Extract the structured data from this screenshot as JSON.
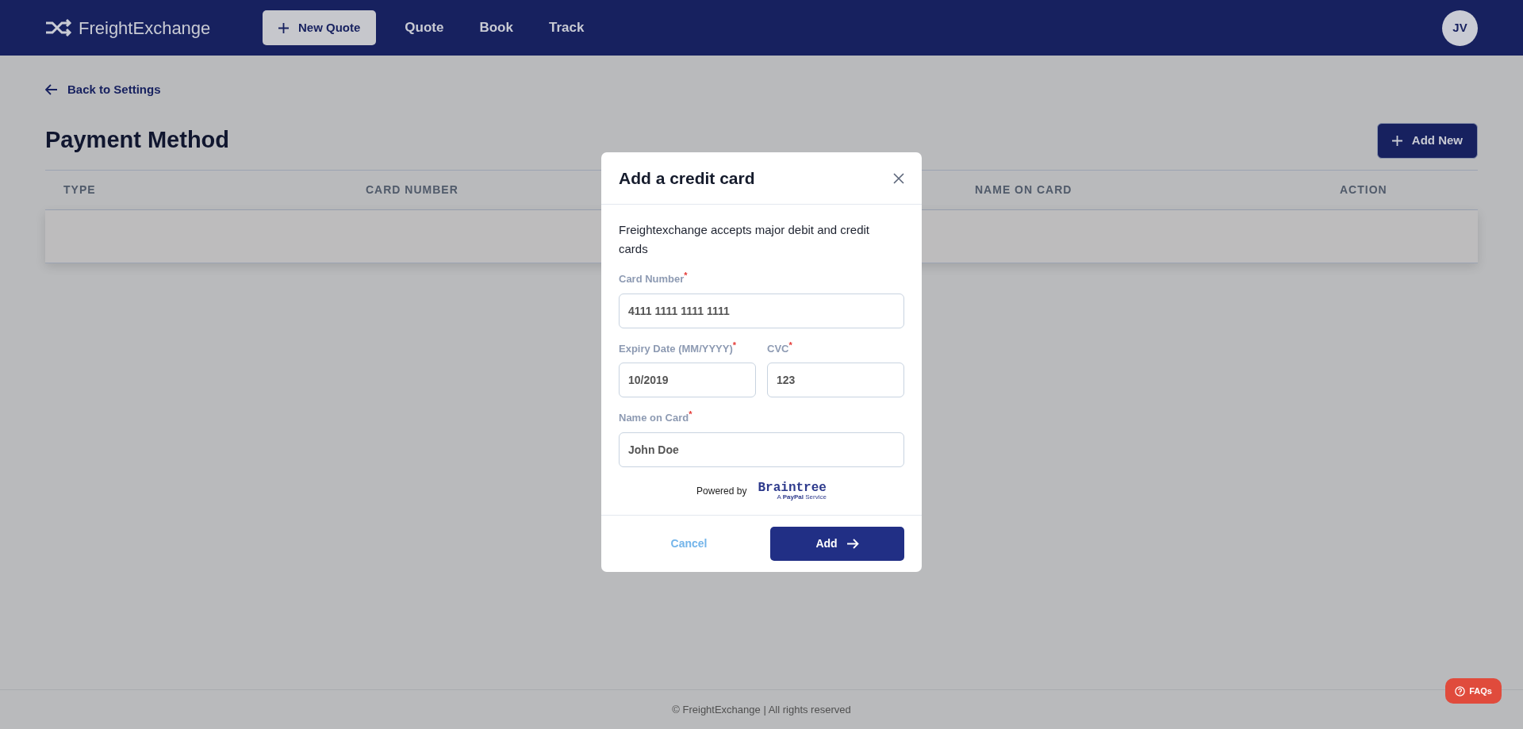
{
  "header": {
    "brand": "FreightExchange",
    "new_quote": "New Quote",
    "nav": [
      {
        "label": "Quote"
      },
      {
        "label": "Book"
      },
      {
        "label": "Track"
      }
    ],
    "avatar": "JV"
  },
  "back_link": "Back to Settings",
  "page_title": "Payment Method",
  "add_new": "Add New",
  "table": {
    "columns": [
      {
        "label": "TYPE"
      },
      {
        "label": "CARD NUMBER"
      },
      {
        "label": "NAME ON CARD"
      },
      {
        "label": "ACTION"
      }
    ]
  },
  "modal": {
    "title": "Add a credit card",
    "intro": "Freightexchange accepts major debit and credit cards",
    "fields": [
      {
        "label": "Card Number",
        "required_mark": "*",
        "value": "4111 1111 1111 1111"
      },
      {
        "label": "Expiry Date (MM/YYYY)",
        "required_mark": "*",
        "value": "10/2019"
      },
      {
        "label": "CVC",
        "required_mark": "*",
        "value": "123"
      },
      {
        "label": "Name on Card",
        "required_mark": "*",
        "value": "John Doe"
      }
    ],
    "powered_by": "Powered by",
    "logo_name": "Braintree",
    "logo_tagline": "A **PayPal** Service",
    "cancel": "Cancel",
    "submit": "Add"
  },
  "footer": "© FreightExchange | All rights reserved",
  "faq": "FAQs"
}
